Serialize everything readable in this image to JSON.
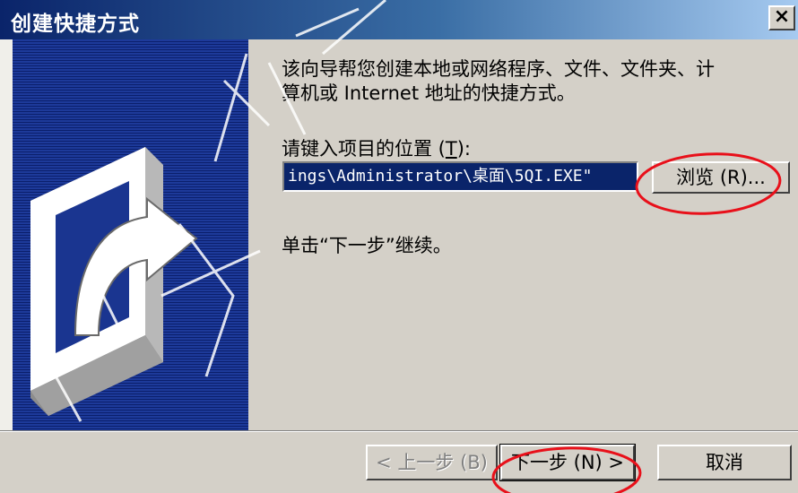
{
  "window": {
    "title": "创建快捷方式",
    "close_label": "×"
  },
  "wizard": {
    "description": "该向导帮您创建本地或网络程序、文件、文件夹、计\n算机或 Internet 地址的快捷方式。",
    "location_label_prefix": "请键入项目的位置 (",
    "location_label_mnemonic": "T",
    "location_label_suffix": "):",
    "location_value": "ings\\Administrator\\桌面\\5QI.EXE\"",
    "browse_label": "浏览 (R)...",
    "hint": "单击“下一步”继续。",
    "icon": "shortcut-arrow-icon"
  },
  "footer": {
    "back_label": "< 上一步 (B)",
    "next_label": "下一步 (N) >",
    "cancel_label": "取消"
  },
  "annotations": {
    "circle_color": "#e8101a",
    "circles": [
      "browse-button",
      "next-button"
    ]
  },
  "colors": {
    "selection": "#0a246a",
    "panel": "#d4d0c8"
  }
}
